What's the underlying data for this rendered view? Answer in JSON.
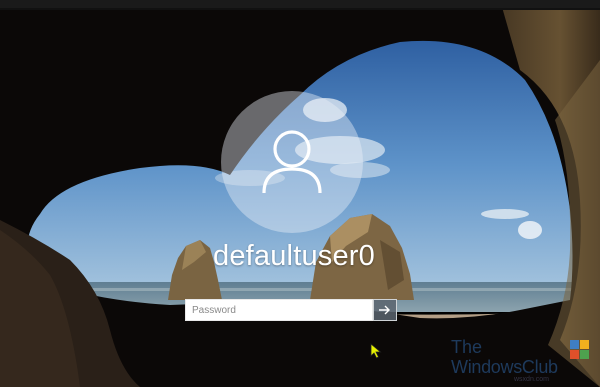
{
  "lockscreen": {
    "username": "defaultuser0",
    "password_placeholder": "Password",
    "avatar_icon": "user-icon",
    "submit_icon": "arrow-right-icon",
    "cursor_icon": "mouse-pointer-icon"
  },
  "watermark": {
    "line1": "The",
    "line2": "WindowsClub",
    "url": "wsxdn.com",
    "logo_icon": "windows-club-logo-icon"
  },
  "colors": {
    "cursor": "#e6f000",
    "accent_blue": "#3f7ec4"
  }
}
